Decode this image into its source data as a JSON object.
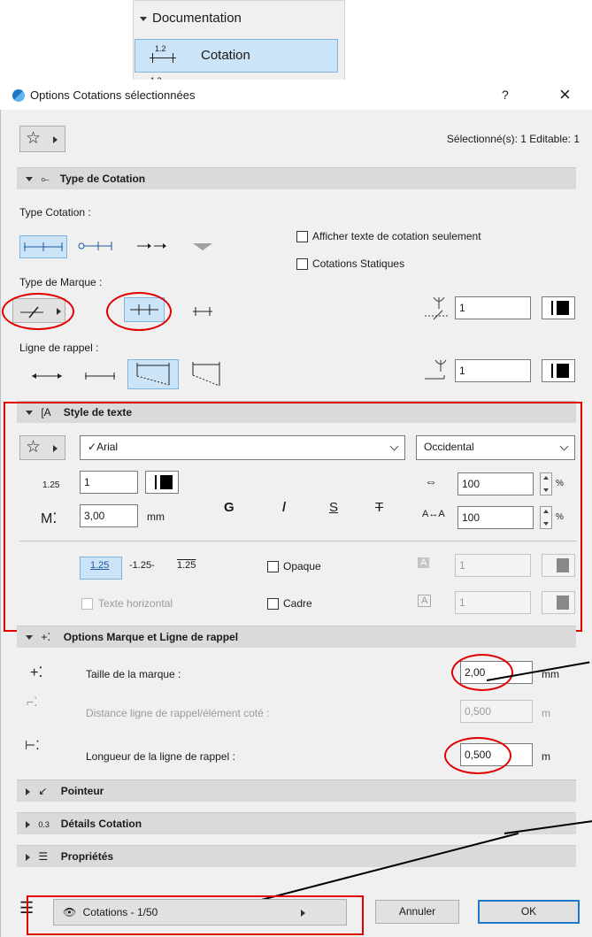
{
  "panel": {
    "section": "Documentation",
    "item": "Cotation",
    "item_icon_text": "1.2",
    "peek_icon_text": "1.2"
  },
  "dialog": {
    "title": "Options Cotations sélectionnées",
    "help": "?",
    "close": "×",
    "selected_info": "Sélectionné(s): 1 Editable: 1"
  },
  "type_cotation": {
    "header": "Type de Cotation",
    "type_label": "Type Cotation :",
    "show_text_only": "Afficher texte de cotation seulement",
    "static": "Cotations Statiques",
    "marker_label": "Type de Marque :",
    "marker_pen": "1",
    "witness_label": "Ligne de rappel :",
    "witness_pen": "1"
  },
  "text_style": {
    "header": "Style de texte",
    "font": "Arial",
    "script": "Occidental",
    "size_icon": "1.25",
    "pen": "1",
    "spacing": "3,00",
    "spacing_unit": "mm",
    "bold": "G",
    "italic": "/",
    "underline": "S",
    "strike": "T",
    "width_pct": "100",
    "spacing_pct": "100",
    "pct": "%",
    "pos_a": "1.25",
    "pos_b": "-1.25-",
    "pos_c": "1.25",
    "opaque": "Opaque",
    "horizontal": "Texte horizontal",
    "frame": "Cadre",
    "fill_pen": "1",
    "frame_pen": "1"
  },
  "marker_options": {
    "header": "Options Marque et Ligne de rappel",
    "marker_size_label": "Taille de la marque :",
    "marker_size": "2,00",
    "marker_size_unit": "mm",
    "distance_label": "Distance ligne de rappel/élément coté :",
    "distance": "0,500",
    "distance_unit": "m",
    "length_label": "Longueur de la ligne de rappel :",
    "length": "0,500",
    "length_unit": "m"
  },
  "collapsed": {
    "pointer": "Pointeur",
    "details": "Détails Cotation",
    "properties": "Propriétés"
  },
  "footer": {
    "layer": "Cotations - 1/50",
    "cancel": "Annuler",
    "ok": "OK"
  },
  "colors": {
    "accent": "#1e78c8",
    "highlight_red": "#e10000",
    "header_bg": "#dadada",
    "selected_bg": "#cce4f7"
  }
}
